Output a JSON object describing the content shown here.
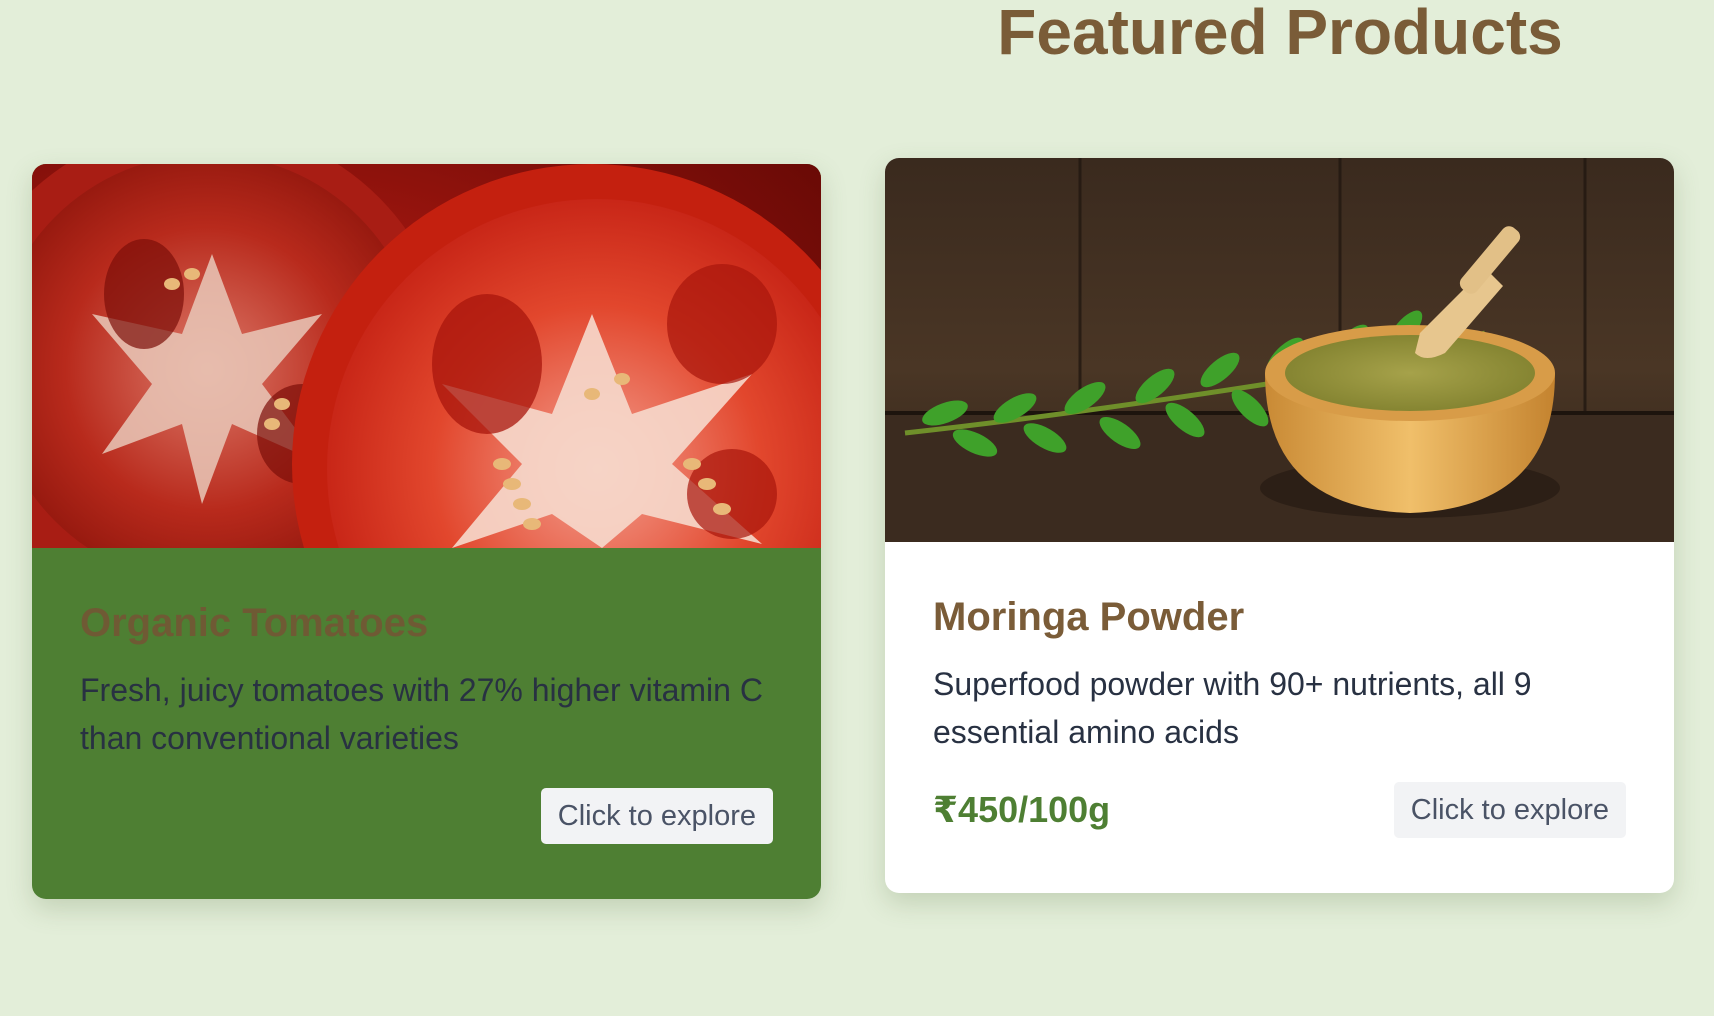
{
  "section": {
    "title": "Featured Products"
  },
  "products": [
    {
      "name": "Organic Tomatoes",
      "description": "Fresh, juicy tomatoes with 27% higher vitamin C than conventional varieties",
      "price": "",
      "cta_label": "Click to explore",
      "card_color": "#4e7f33"
    },
    {
      "name": "Moringa Powder",
      "description": "Superfood powder with 90+ nutrients, all 9 essential amino acids",
      "price": "₹450/100g",
      "cta_label": "Click to explore",
      "card_color": "#ffffff"
    }
  ],
  "colors": {
    "page_background": "#e3eed9",
    "heading_brown": "#7a5c38",
    "accent_green": "#4e7f33",
    "body_text": "#283142",
    "button_background": "#f2f3f5"
  }
}
